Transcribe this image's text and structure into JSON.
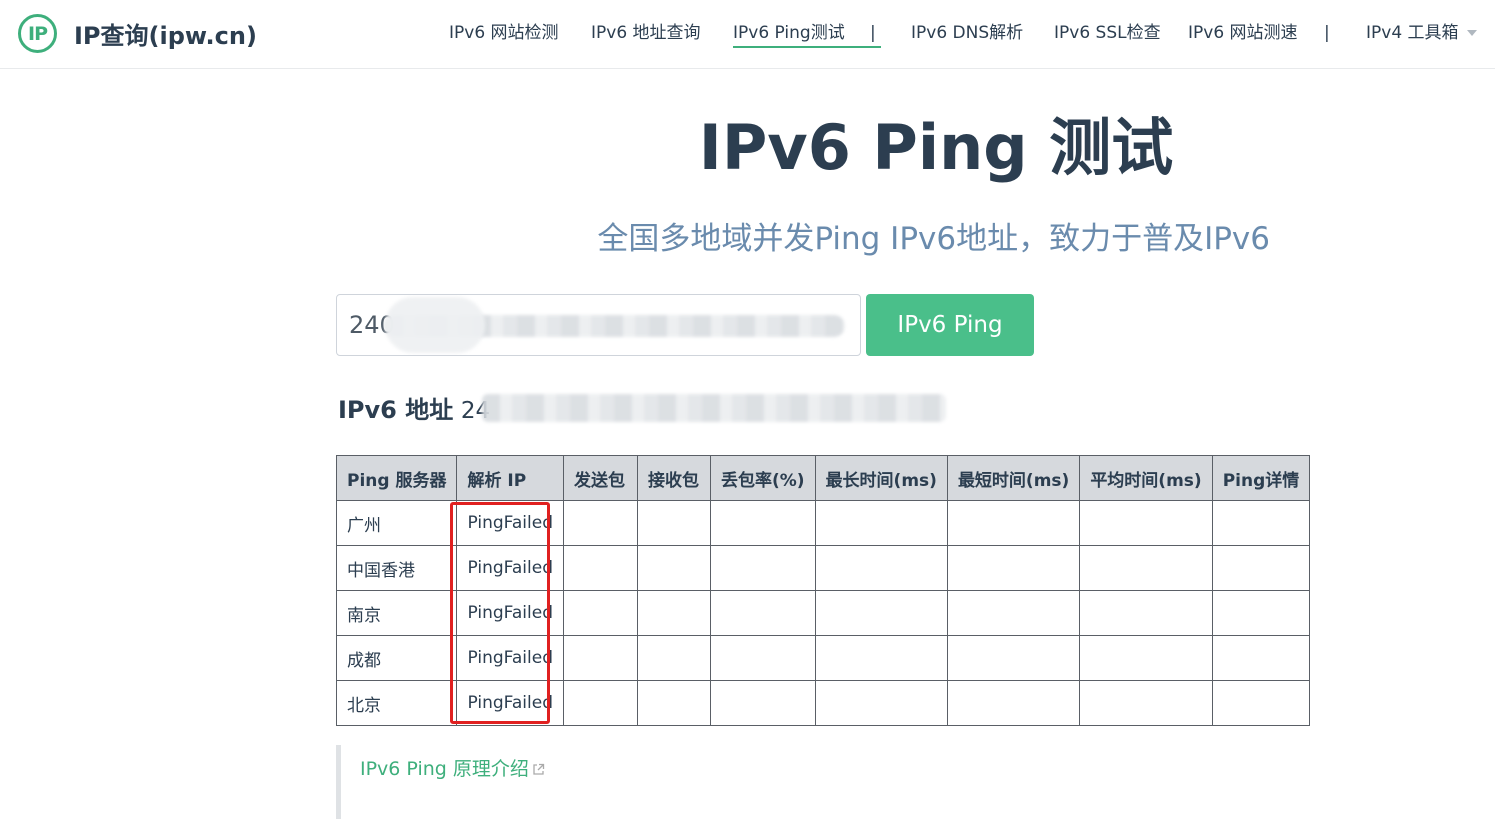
{
  "header": {
    "logo_mark": "IP",
    "logo_text": "IP查询(ipw.cn)",
    "nav": [
      {
        "label": "IPv6 网站检测"
      },
      {
        "label": "IPv6 地址查询"
      },
      {
        "label": "IPv6 Ping测试"
      },
      {
        "label": "IPv6 DNS解析"
      },
      {
        "label": "IPv6 SSL检查"
      },
      {
        "label": "IPv6 网站测速"
      },
      {
        "label": "IPv4 工具箱"
      }
    ],
    "separator": "|",
    "active_color": "#3eaf7c"
  },
  "main": {
    "title": "IPv6 Ping 测试",
    "subtitle": "全国多地域并发Ping IPv6地址，致力于普及IPv6",
    "input_value": "240",
    "button_label": "IPv6 Ping",
    "address_label": "IPv6 地址",
    "address_value": "24",
    "table": {
      "headers": [
        "Ping 服务器",
        "解析 IP",
        "发送包",
        "接收包",
        "丢包率(%)",
        "最长时间(ms)",
        "最短时间(ms)",
        "平均时间(ms)",
        "Ping详情"
      ],
      "rows": [
        {
          "server": "广州",
          "ip": "PingFailed"
        },
        {
          "server": "中国香港",
          "ip": "PingFailed"
        },
        {
          "server": "南京",
          "ip": "PingFailed"
        },
        {
          "server": "成都",
          "ip": "PingFailed"
        },
        {
          "server": "北京",
          "ip": "PingFailed"
        }
      ]
    },
    "tip_link": "IPv6 Ping 原理介绍"
  },
  "colors": {
    "brand": "#3eaf7c",
    "button": "#4abf8a",
    "subtitle": "#6a8bad",
    "highlight": "#e02020"
  },
  "icons": [
    "ip-logo-icon",
    "chevron-down-icon",
    "external-link-icon"
  ]
}
